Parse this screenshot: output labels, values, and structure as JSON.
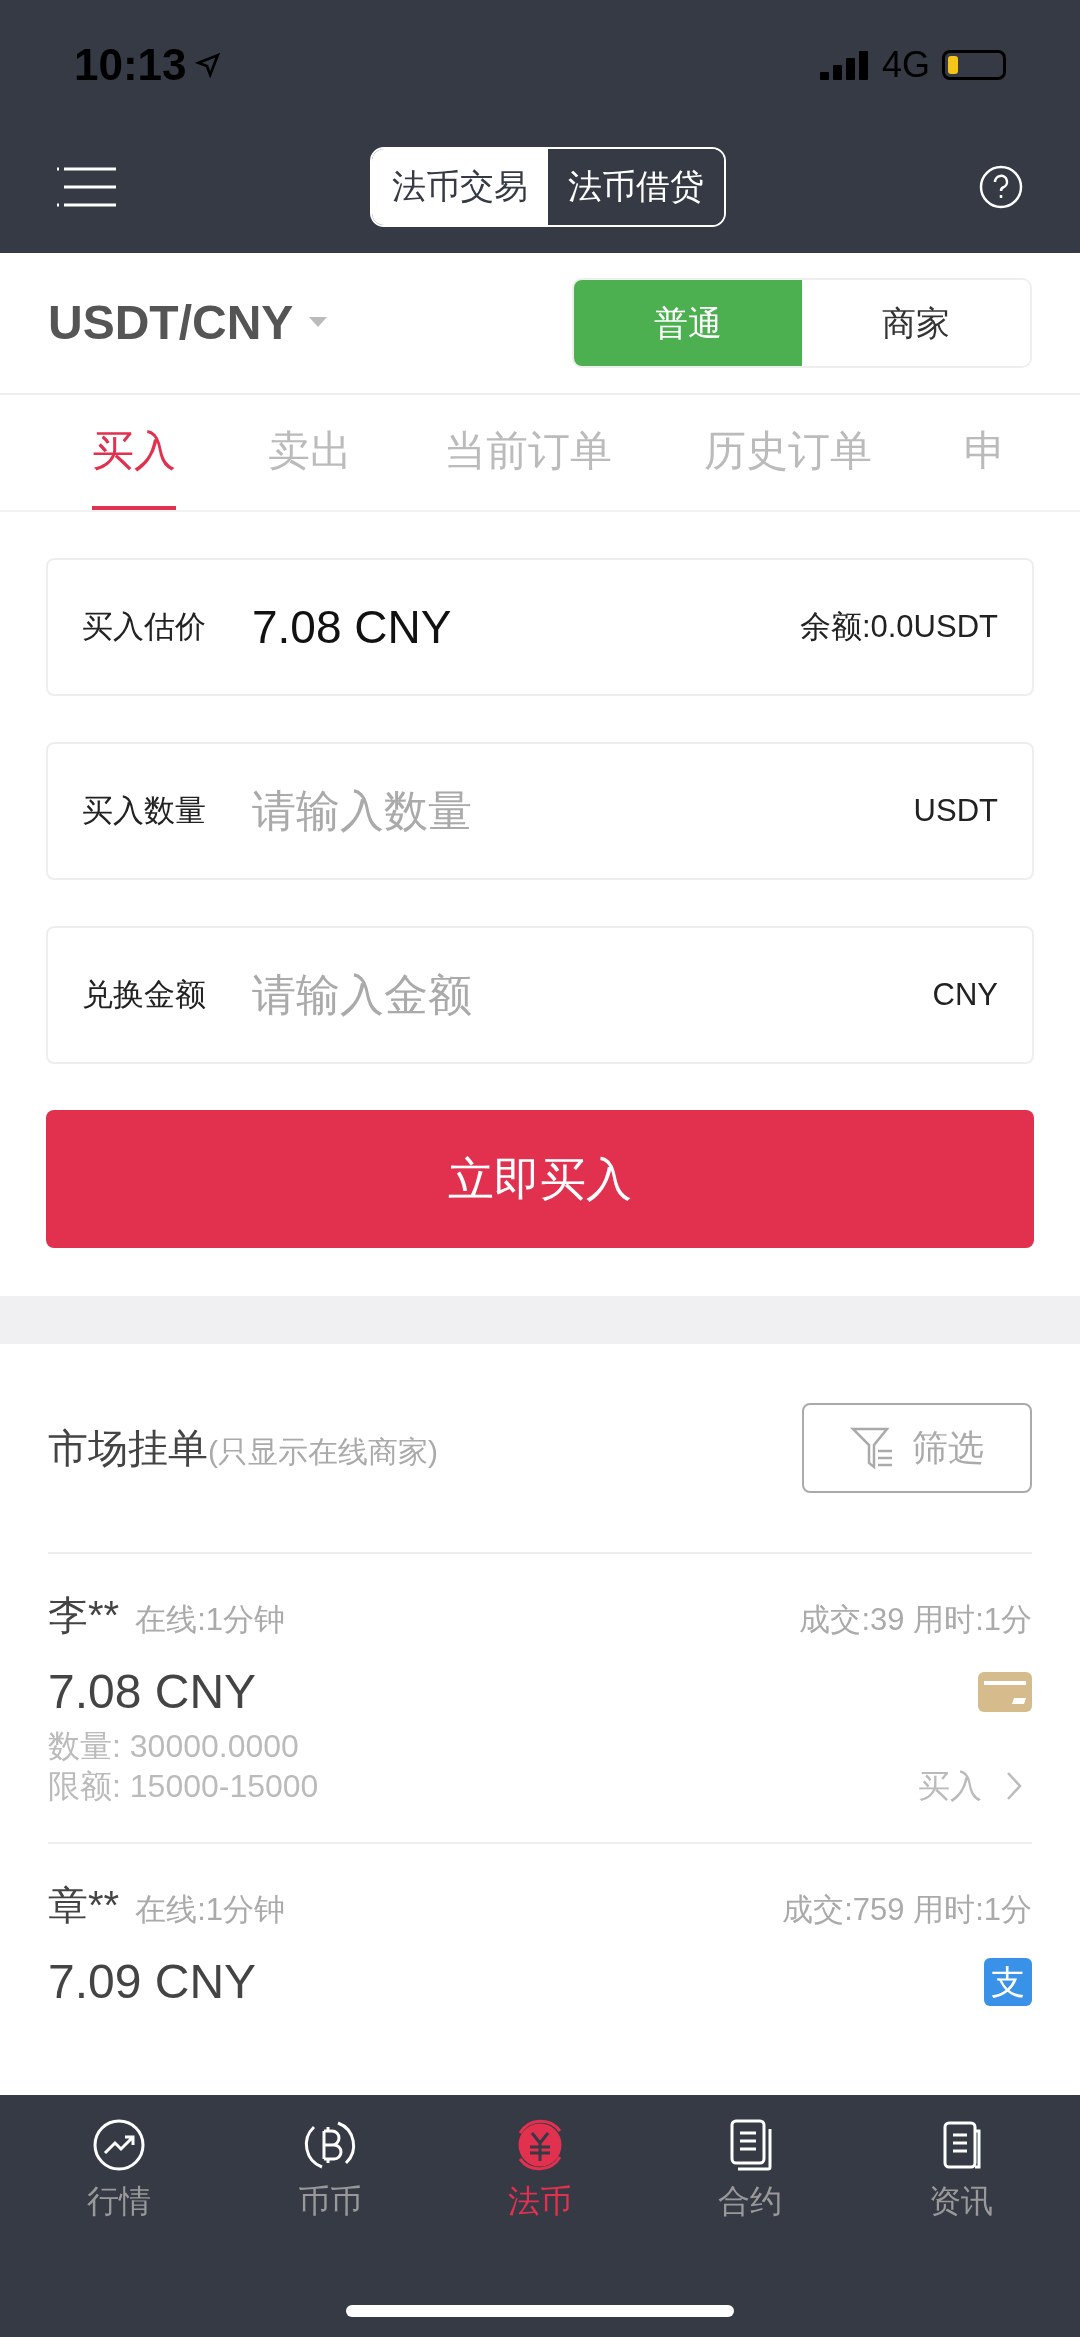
{
  "status_bar": {
    "time": "10:13",
    "network": "4G"
  },
  "header": {
    "segments": [
      {
        "label": "法币交易",
        "selected": true
      },
      {
        "label": "法币借贷",
        "selected": false
      }
    ]
  },
  "pair": {
    "label": "USDT/CNY",
    "modes": [
      {
        "label": "普通",
        "selected": true
      },
      {
        "label": "商家",
        "selected": false
      }
    ]
  },
  "tabs": [
    {
      "label": "买入",
      "selected": true
    },
    {
      "label": "卖出",
      "selected": false
    },
    {
      "label": "当前订单",
      "selected": false
    },
    {
      "label": "历史订单",
      "selected": false
    },
    {
      "label": "申",
      "selected": false
    }
  ],
  "form": {
    "fields": [
      {
        "kind": "readout",
        "label": "买入估价",
        "value": "7.08 CNY",
        "suffix": "余额:0.0USDT"
      },
      {
        "kind": "input",
        "label": "买入数量",
        "placeholder": "请输入数量",
        "suffix": "USDT"
      },
      {
        "kind": "input",
        "label": "兑换金额",
        "placeholder": "请输入金额",
        "suffix": "CNY"
      }
    ],
    "submit": "立即买入"
  },
  "market": {
    "title": "市场挂单",
    "note": "(只显示在线商家)",
    "filter": "筛选",
    "listings": [
      {
        "name": "李**",
        "online": "在线:1分钟",
        "stats": "成交:39 用时:1分",
        "price": "7.08 CNY",
        "quantity": "数量: 30000.0000",
        "limit": "限额: 15000-15000",
        "payment": {
          "kind": "card"
        },
        "action": "买入"
      },
      {
        "name": "章**",
        "online": "在线:1分钟",
        "stats": "成交:759 用时:1分",
        "price": "7.09 CNY",
        "payment": {
          "kind": "alipay",
          "label": "支"
        }
      }
    ]
  },
  "nav": [
    {
      "kind": "chart",
      "label": "行情",
      "selected": false
    },
    {
      "kind": "bitcoin",
      "label": "币币",
      "selected": false
    },
    {
      "kind": "yuan",
      "label": "法币",
      "selected": true
    },
    {
      "kind": "contract",
      "label": "合约",
      "selected": false
    },
    {
      "kind": "news",
      "label": "资讯",
      "selected": false
    }
  ]
}
